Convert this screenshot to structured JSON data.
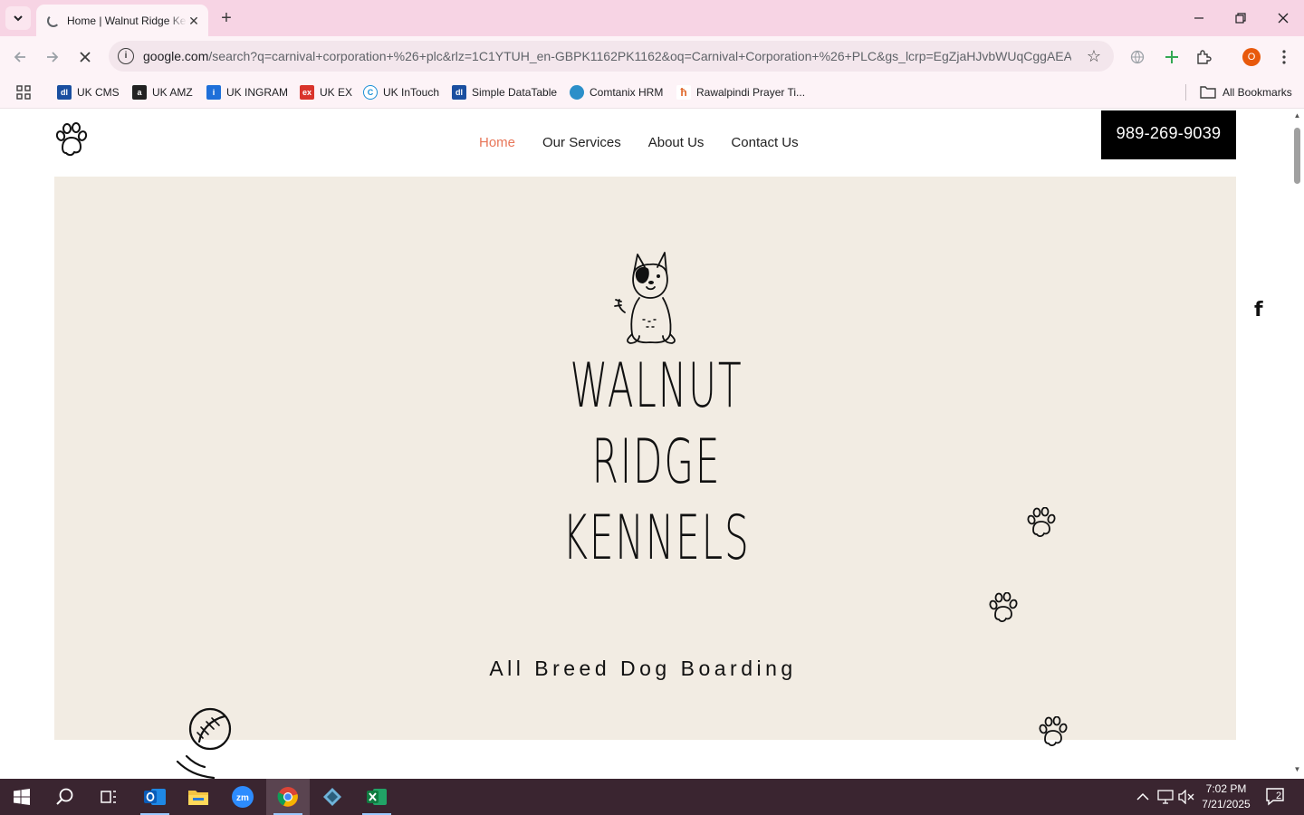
{
  "browser": {
    "tab_title": "Home | Walnut Ridge Kennels",
    "tab_close": "✕",
    "new_tab": "+",
    "url_host": "google.com",
    "url_rest": "/search?q=carnival+corporation+%26+plc&rlz=1C1YTUH_en-GBPK1162PK1162&oq=Carnival+Corporation+%26+PLC&gs_lcrp=EgZjaHJvbWUqCggAEA...",
    "profile_initial": "O",
    "bookmarks": [
      {
        "label": "UK CMS",
        "icon": "dl-icon",
        "color": "#1a4fa0"
      },
      {
        "label": "UK AMZ",
        "icon": "amazon-icon",
        "color": "#222222"
      },
      {
        "label": "UK INGRAM",
        "icon": "ingram-icon",
        "color": "#1e6fd9"
      },
      {
        "label": "UK EX",
        "icon": "ex-icon",
        "color": "#d9342b"
      },
      {
        "label": "UK InTouch",
        "icon": "intouch-icon",
        "color": "#1a8fd6"
      },
      {
        "label": "Simple DataTable",
        "icon": "dl-icon",
        "color": "#1a4fa0"
      },
      {
        "label": "Comtanix HRM",
        "icon": "comtanix-icon",
        "color": "#2b8fc9"
      },
      {
        "label": "Rawalpindi Prayer Ti...",
        "icon": "prayer-icon",
        "color": "#e0692b"
      }
    ],
    "all_bookmarks": "All Bookmarks"
  },
  "site": {
    "nav": [
      "Home",
      "Our Services",
      "About Us",
      "Contact Us"
    ],
    "active_nav": "Home",
    "phone": "989-269-9039",
    "title_lines": [
      "Walnut",
      "Ridge",
      "Kennels"
    ],
    "tagline": "All Breed Dog Boarding",
    "social": "f",
    "accent_color": "#e8775a",
    "hero_bg": "#f2ece3"
  },
  "taskbar": {
    "time": "7:02 PM",
    "date": "7/21/2025",
    "notifications": "2",
    "apps": [
      "start-icon",
      "search-icon",
      "task-view-icon",
      "outlook-icon",
      "file-explorer-icon",
      "zoom-icon",
      "chrome-icon",
      "app-diamond-icon",
      "excel-icon"
    ]
  }
}
